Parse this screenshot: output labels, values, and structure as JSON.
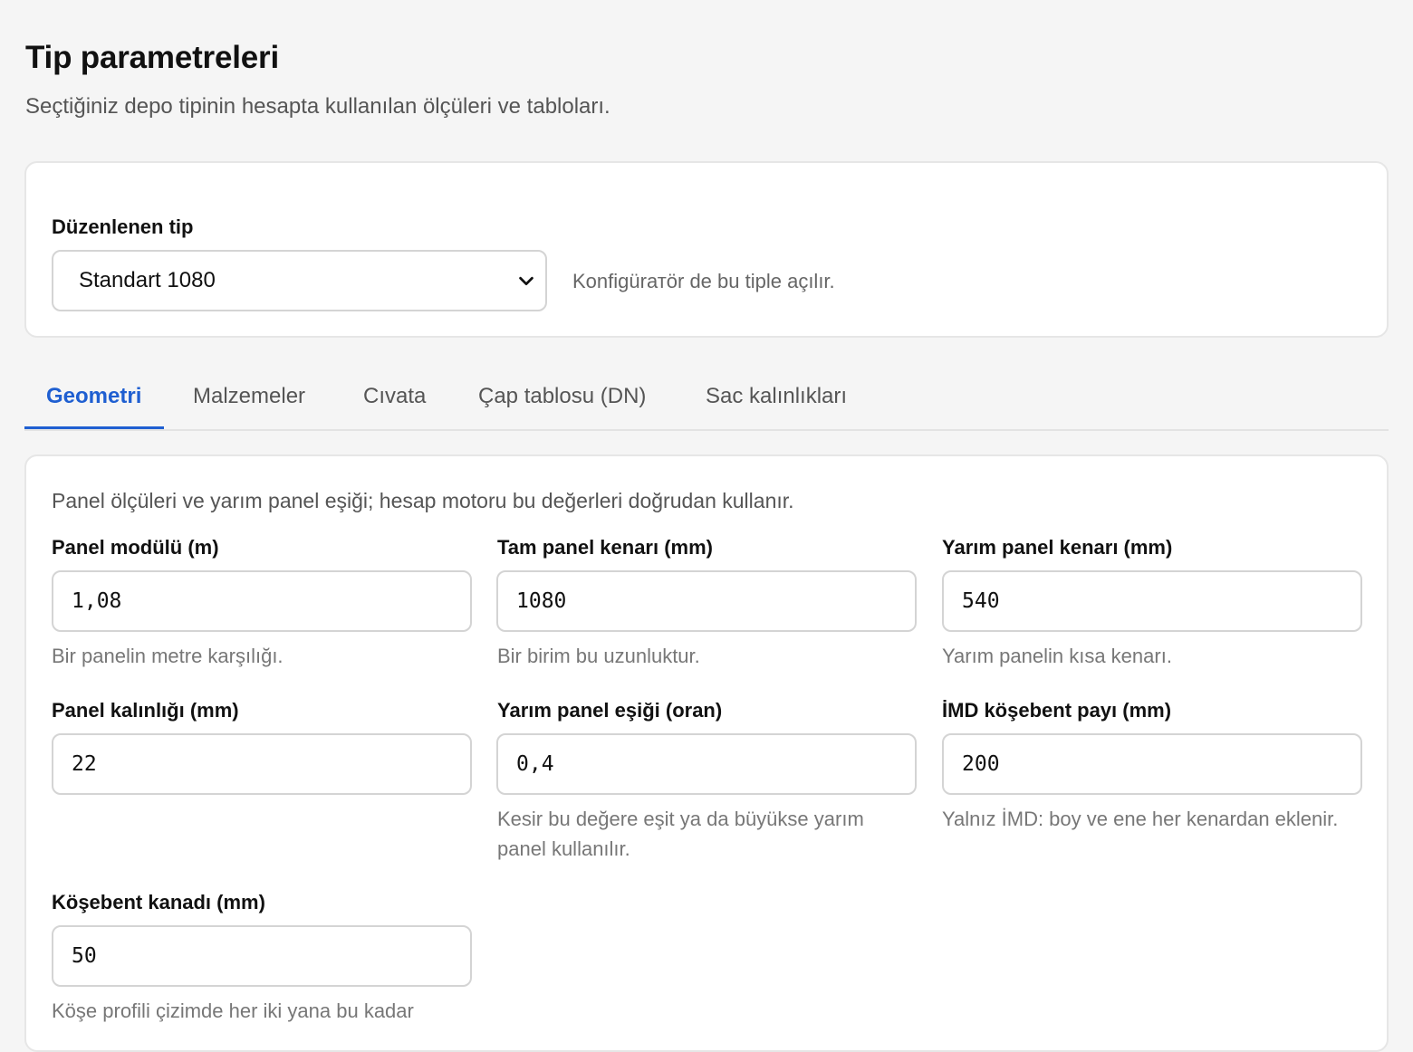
{
  "header": {
    "title": "Tip parametreleri",
    "subtitle": "Seçtiğiniz depo tipinin hesapta kullanılan ölçüleri ve tabloları."
  },
  "type_selector": {
    "label": "Düzenlenen tip",
    "selected": "Standart 1080",
    "hint": "Konfigürатör de bu tiple açılır."
  },
  "tabs": [
    {
      "label": "Geometri",
      "active": true
    },
    {
      "label": "Malzemeler",
      "active": false
    },
    {
      "label": "Cıvata",
      "active": false
    },
    {
      "label": "Çap tablosu (DN)",
      "active": false
    },
    {
      "label": "Sac kalınlıkları",
      "active": false
    }
  ],
  "geometry": {
    "intro": "Panel ölçüleri ve yarım panel eşiği; hesap motoru bu değerleri doğrudan kullanır.",
    "fields": [
      {
        "label": "Panel modülü (m)",
        "value": "1,08",
        "help": "Bir panelin metre karşılığı."
      },
      {
        "label": "Tam panel kenarı (mm)",
        "value": "1080",
        "help": "Bir birim bu uzunluktur."
      },
      {
        "label": "Yarım panel kenarı (mm)",
        "value": "540",
        "help": "Yarım panelin kısa kenarı."
      },
      {
        "label": "Panel kalınlığı (mm)",
        "value": "22",
        "help": ""
      },
      {
        "label": "Yarım panel eşiği (oran)",
        "value": "0,4",
        "help": "Kesir bu değere eşit ya da büyükse yarım panel kullanılır."
      },
      {
        "label": "İMD köşebent payı (mm)",
        "value": "200",
        "help": "Yalnız İMD: boy ve ene her kenardan eklenir."
      },
      {
        "label": "Köşebent kanadı (mm)",
        "value": "50",
        "help": "Köşe profili çizimde her iki yana bu kadar"
      }
    ]
  },
  "colors": {
    "accent": "#1f5fd1",
    "background": "#f5f5f5"
  }
}
